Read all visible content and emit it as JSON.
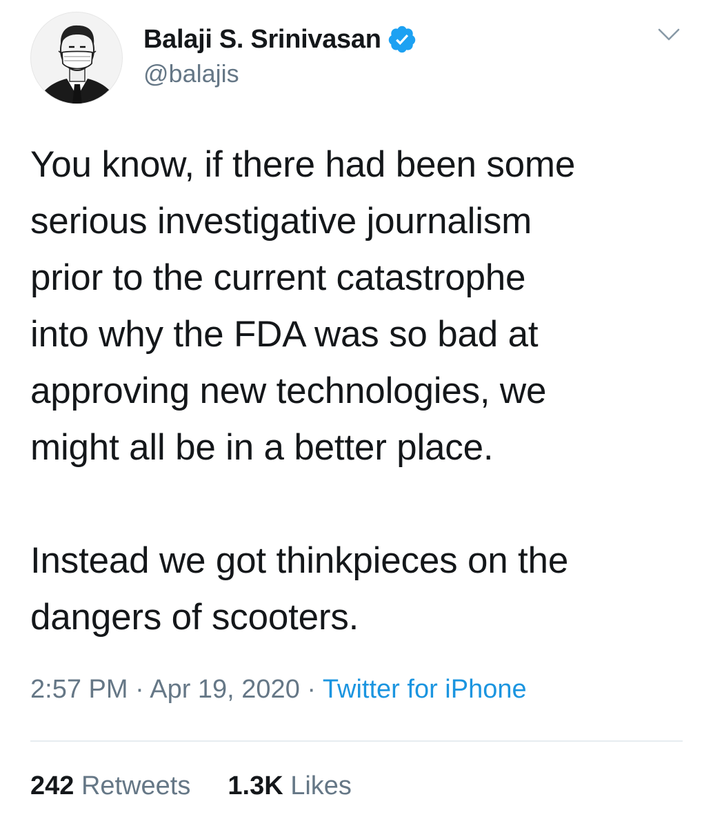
{
  "author": {
    "display_name": "Balaji S. Srinivasan",
    "handle": "@balajis",
    "verified": true,
    "avatar_icon": "masked-man-avatar"
  },
  "menu": {
    "icon": "chevron-down-icon"
  },
  "tweet": {
    "paragraphs": [
      "You know, if there had been some\nserious investigative journalism\nprior to the current catastrophe\ninto why the FDA was so bad at\napproving new technologies, we\nmight all be in a better place.",
      "Instead we got thinkpieces on the\ndangers of scooters."
    ]
  },
  "meta": {
    "time": "2:57 PM",
    "separator": " · ",
    "date": "Apr 19, 2020",
    "source": "Twitter for iPhone"
  },
  "stats": {
    "retweets_count": "242",
    "retweets_label": " Retweets",
    "likes_count": "1.3K",
    "likes_label": " Likes"
  },
  "colors": {
    "text": "#14171a",
    "secondary": "#657786",
    "link": "#1b95e0",
    "verified": "#1da1f2"
  }
}
